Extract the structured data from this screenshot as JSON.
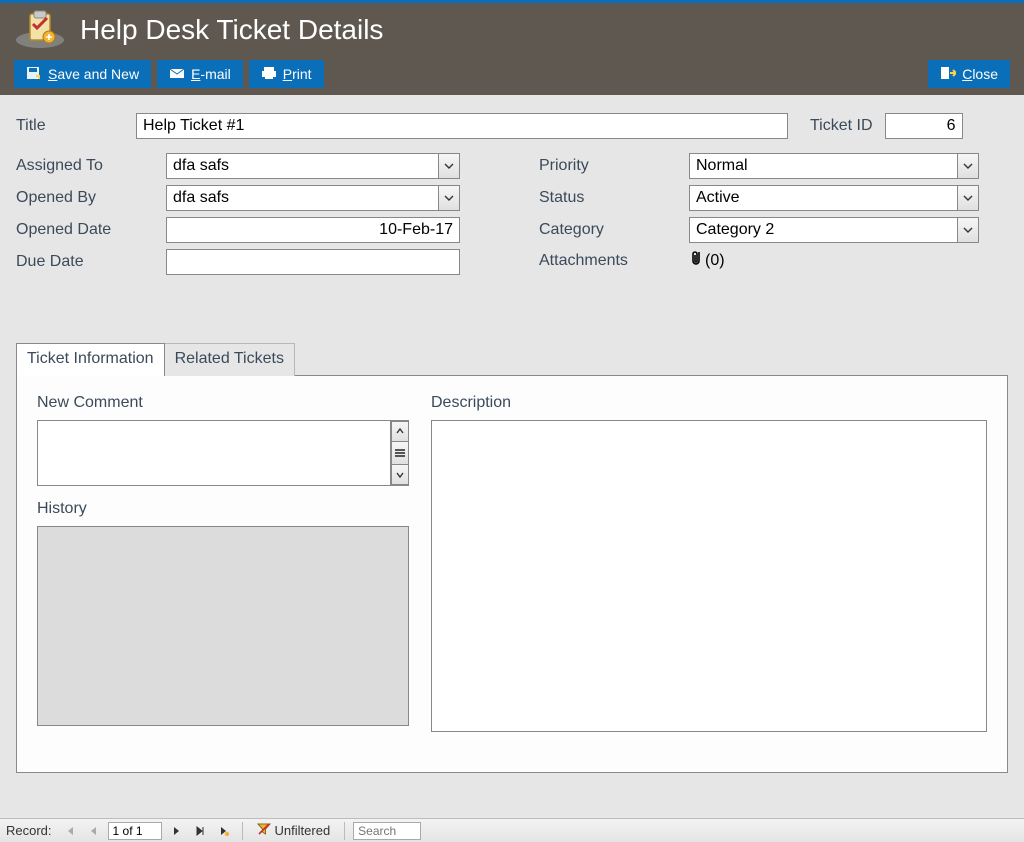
{
  "header": {
    "title": "Help Desk Ticket Details",
    "buttons": {
      "save_and_new": "Save and New",
      "email": "E-mail",
      "print": "Print",
      "close": "Close"
    }
  },
  "form": {
    "labels": {
      "title": "Title",
      "ticket_id": "Ticket ID",
      "assigned_to": "Assigned To",
      "opened_by": "Opened By",
      "opened_date": "Opened Date",
      "due_date": "Due Date",
      "priority": "Priority",
      "status": "Status",
      "category": "Category",
      "attachments": "Attachments"
    },
    "values": {
      "title": "Help Ticket #1",
      "ticket_id": "6",
      "assigned_to": "dfa safs",
      "opened_by": "dfa safs",
      "opened_date": "10-Feb-17",
      "due_date": "",
      "priority": "Normal",
      "status": "Active",
      "category": "Category 2",
      "attachments_count": "(0)"
    }
  },
  "tabs": {
    "ticket_info": "Ticket Information",
    "related": "Related Tickets",
    "sections": {
      "new_comment": "New Comment",
      "history": "History",
      "description": "Description"
    },
    "values": {
      "new_comment": "",
      "history": "",
      "description": ""
    }
  },
  "recordnav": {
    "label": "Record:",
    "position": "1 of 1",
    "filter_label": "Unfiltered",
    "search_placeholder": "Search"
  }
}
